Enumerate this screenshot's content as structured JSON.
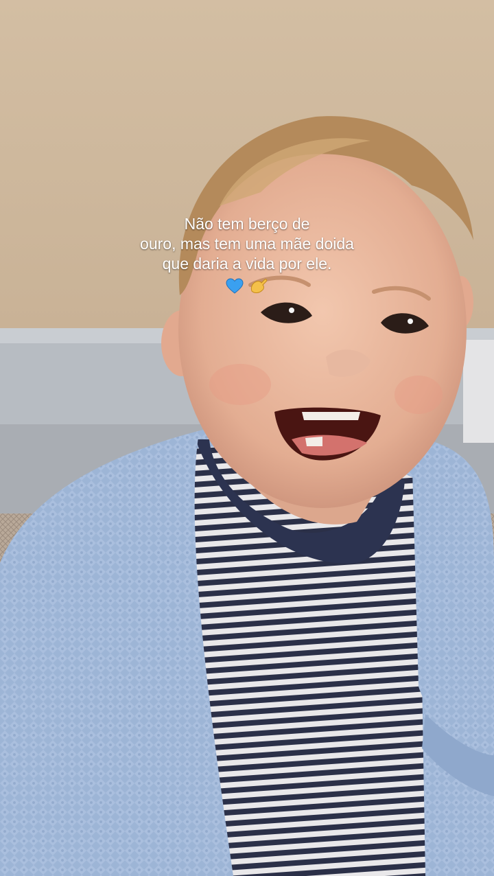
{
  "caption": {
    "lines": [
      "Não tem berço de",
      "ouro, mas tem uma mãe doida",
      "que daria a vida por ele."
    ],
    "emoji_names": [
      "blue-heart-icon",
      "pinched-hand-icon"
    ]
  },
  "colors": {
    "wall": "#cdb79c",
    "crib_rail": "#b9bec4",
    "sweater": "#9fb7d8",
    "shirt_dark": "#2c3350",
    "skin": "#e8b59c",
    "hair": "#b58a5c",
    "heart": "#3aa0f0"
  }
}
